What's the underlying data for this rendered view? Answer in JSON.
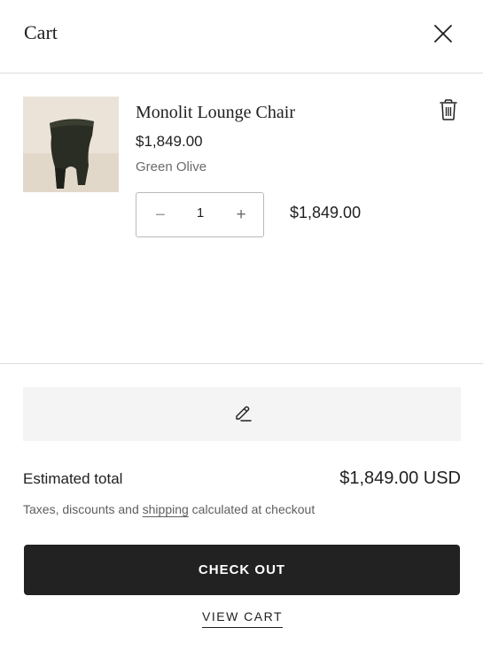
{
  "header": {
    "title": "Cart",
    "close_icon": "close-icon"
  },
  "item": {
    "name": "Monolit Lounge Chair",
    "price": "$1,849.00",
    "variant": "Green Olive",
    "quantity": "1",
    "decrease_symbol": "−",
    "increase_symbol": "+",
    "line_total": "$1,849.00",
    "remove_icon": "trash-icon",
    "image": "product-image-chair"
  },
  "note": {
    "icon": "pencil-icon"
  },
  "summary": {
    "estimated_label": "Estimated total",
    "estimated_value": "$1,849.00 USD",
    "tax_before": "Taxes, discounts and ",
    "tax_link": "shipping",
    "tax_after": " calculated at checkout"
  },
  "actions": {
    "checkout_label": "CHECK OUT",
    "view_cart_label": "VIEW CART"
  },
  "colors": {
    "checkout_bg": "#222222",
    "thumb_bg": "#ebe3d8",
    "note_bg": "#f4f4f4",
    "chair": "#2a2d24"
  }
}
